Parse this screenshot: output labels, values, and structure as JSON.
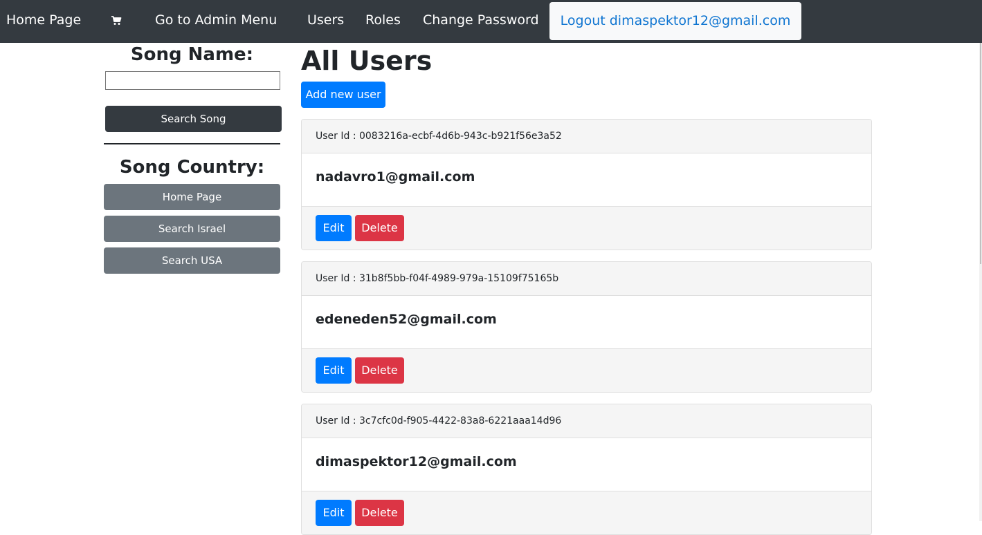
{
  "navbar": {
    "home_label": "Home Page",
    "cart_icon": "cart-icon",
    "admin_label": "Go to Admin Menu",
    "users_label": "Users",
    "roles_label": "Roles",
    "change_password_label": "Change Password",
    "logout_label": "Logout dimaspektor12@gmail.com"
  },
  "sidebar": {
    "song_name_heading": "Song Name:",
    "song_name_value": "",
    "search_song_label": "Search Song",
    "song_country_heading": "Song Country:",
    "country_buttons": [
      "Home Page",
      "Search Israel",
      "Search USA"
    ]
  },
  "main": {
    "title": "All Users",
    "add_user_label": "Add new user",
    "users": [
      {
        "id_text": "User Id : 0083216a-ecbf-4d6b-943c-b921f56e3a52",
        "email": "nadavro1@gmail.com"
      },
      {
        "id_text": "User Id : 31b8f5bb-f04f-4989-979a-15109f75165b",
        "email": "edeneden52@gmail.com"
      },
      {
        "id_text": "User Id : 3c7cfc0d-f905-4422-83a8-6221aaa14d96",
        "email": "dimaspektor12@gmail.com"
      }
    ],
    "edit_label": "Edit",
    "delete_label": "Delete"
  },
  "colors": {
    "navbar": "#343a40",
    "primary": "#007bff",
    "danger": "#dc3545",
    "secondary": "#6c757d",
    "dark": "#343a40"
  }
}
